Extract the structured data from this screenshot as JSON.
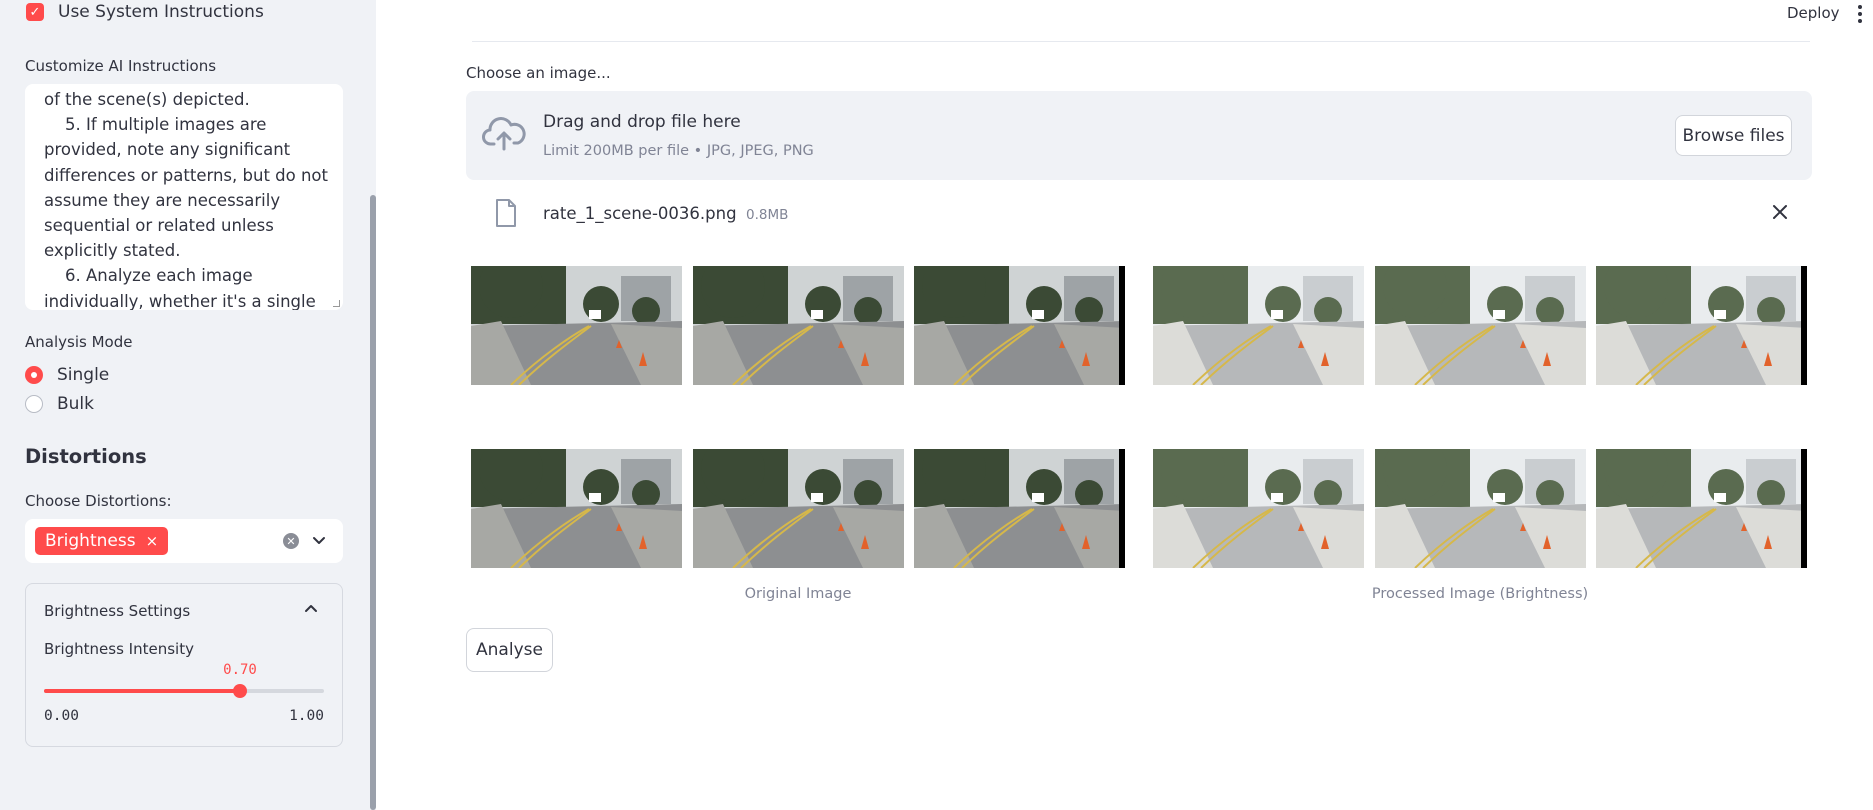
{
  "sidebar": {
    "use_system_instructions": {
      "label": "Use System Instructions",
      "checked": true
    },
    "customize_label": "Customize AI Instructions",
    "instructions_text": "of the scene(s) depicted.\n    5. If multiple images are provided, note any significant differences or patterns, but do not assume they are necessarily sequential or related unless explicitly stated.\n    6. Analyze each image individually, whether it's a single frame or part of a set.",
    "analysis_mode": {
      "label": "Analysis Mode",
      "options": [
        {
          "label": "Single",
          "selected": true
        },
        {
          "label": "Bulk",
          "selected": false
        }
      ]
    },
    "distortions_title": "Distortions",
    "choose_distortions_label": "Choose Distortions:",
    "selected_distortion": "Brightness",
    "tag_remove": "×",
    "settings": {
      "title": "Brightness Settings",
      "slider_label": "Brightness Intensity",
      "value_text": "0.70",
      "value": 0.7,
      "min_text": "0.00",
      "max_text": "1.00",
      "min": 0,
      "max": 1
    }
  },
  "header": {
    "deploy_label": "Deploy"
  },
  "main": {
    "uploader_label": "Choose an image...",
    "dropzone_title": "Drag and drop file here",
    "dropzone_subtitle": "Limit 200MB per file • JPG, JPEG, PNG",
    "browse_label": "Browse files",
    "file": {
      "name": "rate_1_scene-0036.png",
      "size": "0.8MB"
    },
    "original_caption": "Original Image",
    "processed_caption": "Processed Image (Brightness)",
    "analyse_label": "Analyse"
  },
  "colors": {
    "accent": "#ff4b4b",
    "sidebar_bg": "#f0f2f6",
    "text": "#31333f",
    "muted": "#808495"
  },
  "icons": [
    "check-icon",
    "cloud-upload-icon",
    "file-icon",
    "close-icon",
    "clear-icon",
    "chevron-down-icon",
    "chevron-up-icon",
    "more-vert-icon"
  ]
}
